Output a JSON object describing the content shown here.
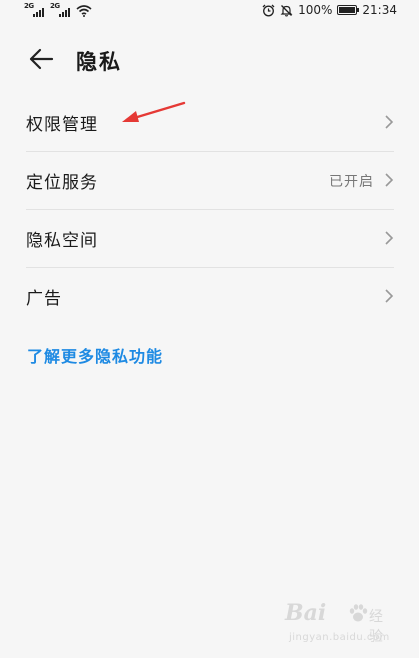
{
  "status_bar": {
    "network_label_1": "2G",
    "network_label_2": "2G",
    "battery_percent": "100%",
    "time": "21:34",
    "icons": [
      "signal-icon",
      "wifi-icon",
      "alarm-icon",
      "mute-icon",
      "battery-icon"
    ]
  },
  "header": {
    "title": "隐私"
  },
  "menu": {
    "items": [
      {
        "label": "权限管理",
        "value": ""
      },
      {
        "label": "定位服务",
        "value": "已开启"
      },
      {
        "label": "隐私空间",
        "value": ""
      },
      {
        "label": "广告",
        "value": ""
      }
    ]
  },
  "link": {
    "label": "了解更多隐私功能"
  },
  "watermark": {
    "logo": "Bai",
    "brand": "经验",
    "url": "jingyan.baidu.com"
  },
  "colors": {
    "background": "#f6f6f6",
    "link": "#1e8ae3",
    "annotation_arrow": "#e53935",
    "divider": "#e2e2e2"
  }
}
